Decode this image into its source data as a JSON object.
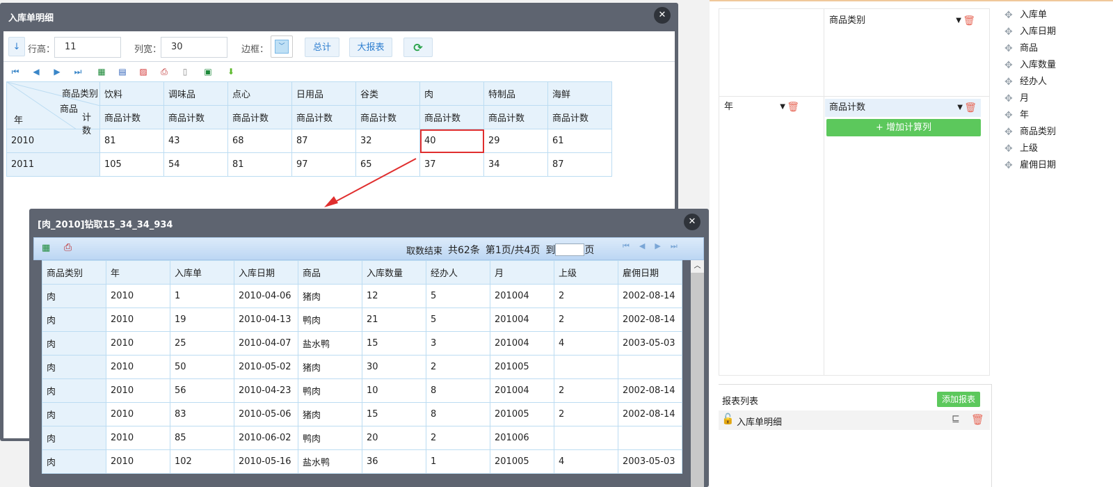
{
  "detail_window": {
    "title": "入库单明细",
    "toolbar": {
      "row_height_label": "行高：",
      "row_height": "11",
      "col_width_label": "列宽：",
      "col_width": "30",
      "border_label": "边框：",
      "total_btn": "总计",
      "big_report_btn": "大报表"
    },
    "pivot": {
      "corner": {
        "col_dim": "商品类别",
        "row_dim": "年",
        "measure_a": "商品",
        "measure_b": "计数"
      },
      "columns": [
        "饮料",
        "调味品",
        "点心",
        "日用品",
        "谷类",
        "肉",
        "特制品",
        "海鲜"
      ],
      "measure": "商品计数",
      "rows": [
        {
          "year": "2010",
          "values": [
            "81",
            "43",
            "68",
            "87",
            "32",
            "40",
            "29",
            "61"
          ]
        },
        {
          "year": "2011",
          "values": [
            "105",
            "54",
            "81",
            "97",
            "65",
            "37",
            "34",
            "87"
          ]
        }
      ]
    }
  },
  "drill_window": {
    "title": "[肉_2010]钻取15_34_34_934",
    "pager": {
      "status": "取数结束",
      "total": "共62条",
      "page": "第1页/共4页",
      "goto": "到",
      "unit": "页"
    },
    "headers": [
      "商品类别",
      "年",
      "入库单",
      "入库日期",
      "商品",
      "入库数量",
      "经办人",
      "月",
      "上级",
      "雇佣日期"
    ],
    "rows": [
      [
        "肉",
        "2010",
        "1",
        "2010-04-06",
        "猪肉",
        "12",
        "5",
        "201004",
        "2",
        "2002-08-14"
      ],
      [
        "肉",
        "2010",
        "19",
        "2010-04-13",
        "鸭肉",
        "21",
        "5",
        "201004",
        "2",
        "2002-08-14"
      ],
      [
        "肉",
        "2010",
        "25",
        "2010-04-07",
        "盐水鸭",
        "15",
        "3",
        "201004",
        "4",
        "2003-05-03"
      ],
      [
        "肉",
        "2010",
        "50",
        "2010-05-02",
        "猪肉",
        "30",
        "2",
        "201005",
        "",
        ""
      ],
      [
        "肉",
        "2010",
        "56",
        "2010-04-23",
        "鸭肉",
        "10",
        "8",
        "201004",
        "2",
        "2002-08-14"
      ],
      [
        "肉",
        "2010",
        "83",
        "2010-05-06",
        "猪肉",
        "15",
        "8",
        "201005",
        "2",
        "2002-08-14"
      ],
      [
        "肉",
        "2010",
        "85",
        "2010-06-02",
        "鸭肉",
        "20",
        "2",
        "201006",
        "",
        ""
      ],
      [
        "肉",
        "2010",
        "102",
        "2010-05-16",
        "盐水鸭",
        "36",
        "1",
        "201005",
        "4",
        "2003-05-03"
      ]
    ]
  },
  "config": {
    "col_chip": "商品类别",
    "row_chip": "年",
    "measure_chip": "商品计数",
    "add_calc": "+ 增加计算列"
  },
  "fields": [
    "入库单",
    "入库日期",
    "商品",
    "入库数量",
    "经办人",
    "月",
    "年",
    "商品类别",
    "上级",
    "雇佣日期"
  ],
  "reports": {
    "title": "报表列表",
    "add": "添加报表",
    "item": "入库单明细"
  }
}
